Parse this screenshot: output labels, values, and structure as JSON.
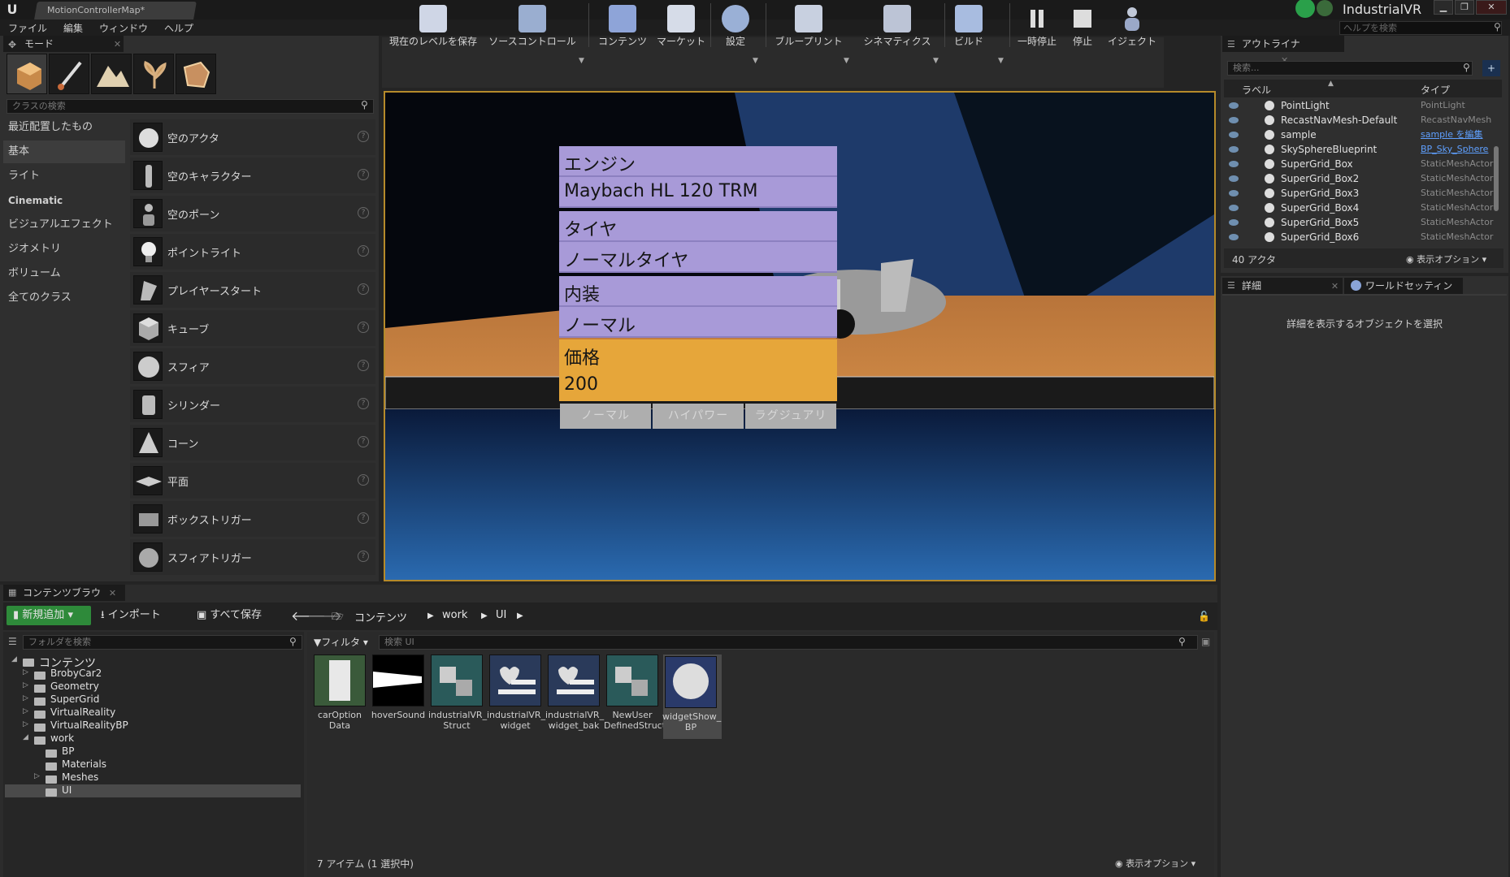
{
  "window": {
    "doc_tab": "MotionControllerMap*",
    "project": "IndustrialVR",
    "help_search_placeholder": "ヘルプを検索",
    "controls": [
      "▁",
      "❐",
      "✕"
    ]
  },
  "menu": [
    "ファイル",
    "編集",
    "ウィンドウ",
    "ヘルプ"
  ],
  "modes": {
    "tab": "モード",
    "search_placeholder": "クラスの検索",
    "categories": [
      "最近配置したもの",
      "基本",
      "ライト",
      "Cinematic",
      "ビジュアルエフェクト",
      "ジオメトリ",
      "ボリューム",
      "全てのクラス"
    ],
    "selected_category": "基本",
    "actors": [
      "空のアクタ",
      "空のキャラクター",
      "空のポーン",
      "ポイントライト",
      "プレイヤースタート",
      "キューブ",
      "スフィア",
      "シリンダー",
      "コーン",
      "平面",
      "ボックストリガー",
      "スフィアトリガー"
    ]
  },
  "toolbar": {
    "save": "現在のレベルを保存",
    "source": "ソースコントロール",
    "content": "コンテンツ",
    "market": "マーケット",
    "settings": "設定",
    "blueprint": "ブループリント",
    "cinematics": "シネマティクス",
    "build": "ビルド",
    "pause": "一時停止",
    "stop": "停止",
    "eject": "イジェクト"
  },
  "widget": {
    "engine_label": "エンジン",
    "engine_value": "Maybach HL 120 TRM",
    "tire_label": "タイヤ",
    "tire_value": "ノーマルタイヤ",
    "interior_label": "内装",
    "interior_value": "ノーマル",
    "price_label": "価格",
    "price_value": "200",
    "buttons": [
      "ノーマル",
      "ハイパワー",
      "ラグジュアリ"
    ]
  },
  "outliner": {
    "tab": "アウトライナ",
    "search_placeholder": "検索...",
    "col_label": "ラベル",
    "col_type": "タイプ",
    "rows": [
      {
        "name": "PointLight",
        "type": "PointLight",
        "link": false
      },
      {
        "name": "RecastNavMesh-Default",
        "type": "RecastNavMesh",
        "link": false
      },
      {
        "name": "sample",
        "type": "sample を編集",
        "link": true
      },
      {
        "name": "SkySphereBlueprint",
        "type": "BP_Sky_Sphere",
        "link": true
      },
      {
        "name": "SuperGrid_Box",
        "type": "StaticMeshActor",
        "link": false
      },
      {
        "name": "SuperGrid_Box2",
        "type": "StaticMeshActor",
        "link": false
      },
      {
        "name": "SuperGrid_Box3",
        "type": "StaticMeshActor",
        "link": false
      },
      {
        "name": "SuperGrid_Box4",
        "type": "StaticMeshActor",
        "link": false
      },
      {
        "name": "SuperGrid_Box5",
        "type": "StaticMeshActor",
        "link": false
      },
      {
        "name": "SuperGrid_Box6",
        "type": "StaticMeshActor",
        "link": false
      }
    ],
    "count": "40 アクタ",
    "view_options": "表示オプション"
  },
  "details": {
    "tab1": "詳細",
    "tab2": "ワールドセッティン",
    "empty_text": "詳細を表示するオブジェクトを選択"
  },
  "content_browser": {
    "tab": "コンテンツブラウ",
    "add_new": "新規追加",
    "import": "インポート",
    "save_all": "すべて保存",
    "crumbs": [
      "コンテンツ",
      "work",
      "UI"
    ],
    "folder_search_placeholder": "フォルダを検索",
    "filter": "フィルタ",
    "asset_search_placeholder": "検索 UI",
    "tree": [
      {
        "label": "コンテンツ",
        "depth": 0,
        "expander": "◢"
      },
      {
        "label": "BrobyCar2",
        "depth": 1,
        "expander": "▷"
      },
      {
        "label": "Geometry",
        "depth": 1,
        "expander": "▷"
      },
      {
        "label": "SuperGrid",
        "depth": 1,
        "expander": "▷"
      },
      {
        "label": "VirtualReality",
        "depth": 1,
        "expander": "▷"
      },
      {
        "label": "VirtualRealityBP",
        "depth": 1,
        "expander": "▷"
      },
      {
        "label": "work",
        "depth": 1,
        "expander": "◢"
      },
      {
        "label": "BP",
        "depth": 2,
        "expander": ""
      },
      {
        "label": "Materials",
        "depth": 2,
        "expander": ""
      },
      {
        "label": "Meshes",
        "depth": 2,
        "expander": "▷"
      },
      {
        "label": "UI",
        "depth": 2,
        "expander": ""
      }
    ],
    "selected_folder": "UI",
    "assets": [
      {
        "l1": "carOption",
        "l2": "Data"
      },
      {
        "l1": "hoverSound",
        "l2": ""
      },
      {
        "l1": "industrialVR_",
        "l2": "Struct"
      },
      {
        "l1": "industrialVR_",
        "l2": "widget"
      },
      {
        "l1": "industrialVR_",
        "l2": "widget_bak"
      },
      {
        "l1": "NewUser",
        "l2": "DefinedStruct"
      },
      {
        "l1": "widgetShow_",
        "l2": "BP"
      }
    ],
    "status": "7 アイテム (1 選択中)",
    "view_options": "表示オプション"
  }
}
